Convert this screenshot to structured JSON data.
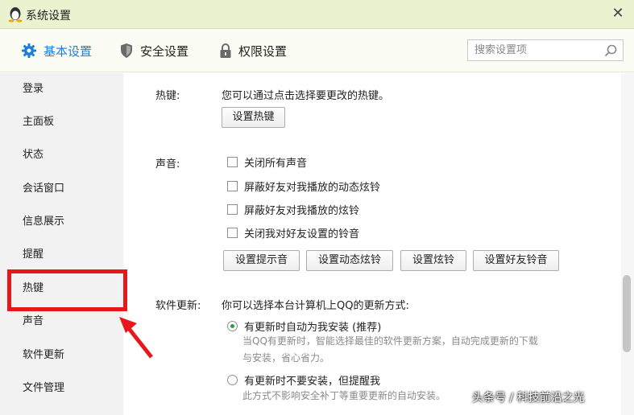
{
  "window": {
    "title": "系统设置",
    "close_glyph": "✕"
  },
  "toolbar": {
    "tabs": [
      {
        "label": "基本设置",
        "icon": "gear-icon"
      },
      {
        "label": "安全设置",
        "icon": "shield-icon"
      },
      {
        "label": "权限设置",
        "icon": "lock-icon"
      }
    ],
    "search_placeholder": "搜索设置项",
    "accent_color": "#1e7fd8"
  },
  "sidebar": {
    "items": [
      {
        "label": "登录"
      },
      {
        "label": "主面板"
      },
      {
        "label": "状态"
      },
      {
        "label": "会话窗口"
      },
      {
        "label": "信息展示"
      },
      {
        "label": "提醒"
      },
      {
        "label": "热键"
      },
      {
        "label": "声音"
      },
      {
        "label": "软件更新"
      },
      {
        "label": "文件管理"
      }
    ],
    "highlight_color": "#e8171c"
  },
  "hotkey": {
    "label": "热键:",
    "description": "您可以通过点击选择要更改的热键。",
    "button": "设置热键"
  },
  "sound": {
    "label": "声音:",
    "options": [
      "关闭所有声音",
      "屏蔽好友对我播放的动态炫铃",
      "屏蔽好友对我播放的炫铃",
      "关闭我对好友设置的铃音"
    ],
    "buttons": [
      "设置提示音",
      "设置动态炫铃",
      "设置炫铃",
      "设置好友铃音"
    ]
  },
  "update": {
    "label": "软件更新:",
    "description": "你可以选择本台计算机上QQ的更新方式:",
    "option1": {
      "label": "有更新时自动为我安装 (推荐)",
      "desc_line1": "当QQ有更新时，智能选择最佳的软件更新方案，自动完成更新的下载",
      "desc_line2": "与安装，省心省力。",
      "selected": true
    },
    "option2": {
      "label": "有更新时不要安装，但提醒我",
      "desc_line1": "此方式不影响安全补丁等重要更新的自动安装。",
      "selected": false
    }
  },
  "watermark": "头条号 / 科技前沿之光"
}
